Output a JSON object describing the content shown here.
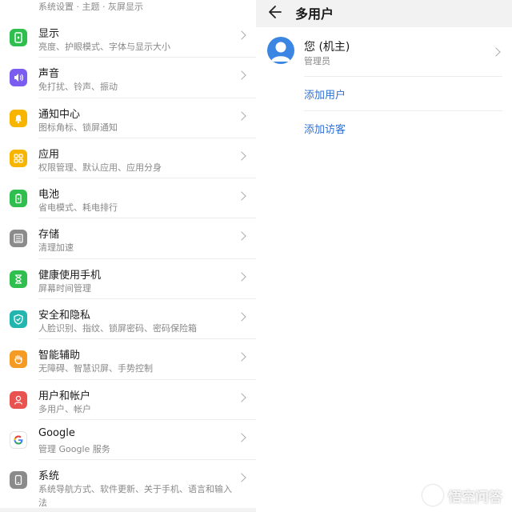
{
  "settings": {
    "partial_top_sub": "系统设置 · 主题 · 灰屏显示",
    "items": [
      {
        "title": "显示",
        "sub": "亮度、护眼模式、字体与显示大小",
        "color": "#2fbf4e",
        "icon": "display-icon"
      },
      {
        "title": "声音",
        "sub": "免打扰、铃声、振动",
        "color": "#7a5cf0",
        "icon": "sound-icon"
      },
      {
        "title": "通知中心",
        "sub": "图标角标、锁屏通知",
        "color": "#f7b500",
        "icon": "bell-icon"
      },
      {
        "title": "应用",
        "sub": "权限管理、默认应用、应用分身",
        "color": "#f7b500",
        "icon": "apps-grid-icon"
      },
      {
        "title": "电池",
        "sub": "省电模式、耗电排行",
        "color": "#2fbf4e",
        "icon": "battery-icon"
      },
      {
        "title": "存储",
        "sub": "清理加速",
        "color": "#8b8b8b",
        "icon": "storage-icon"
      },
      {
        "title": "健康使用手机",
        "sub": "屏幕时间管理",
        "color": "#2fbf4e",
        "icon": "hourglass-icon"
      },
      {
        "title": "安全和隐私",
        "sub": "人脸识别、指纹、锁屏密码、密码保险箱",
        "color": "#23b5b0",
        "icon": "shield-icon"
      },
      {
        "title": "智能辅助",
        "sub": "无障碍、智慧识屏、手势控制",
        "color": "#f59a23",
        "icon": "hand-icon"
      },
      {
        "title": "用户和帐户",
        "sub": "多用户、帐户",
        "color": "#e8524f",
        "icon": "user-icon"
      },
      {
        "title": "Google",
        "sub": "管理 Google 服务",
        "color": "#ffffff",
        "icon": "google-icon"
      },
      {
        "title": "系统",
        "sub": "系统导航方式、软件更新、关于手机、语言和输入法",
        "color": "#8b8b8b",
        "icon": "phone-icon"
      }
    ]
  },
  "multi_user": {
    "title": "多用户",
    "owner_name": "您 (机主)",
    "owner_role": "管理员",
    "add_user": "添加用户",
    "add_guest": "添加访客"
  },
  "watermark": {
    "text": "悟空问答"
  }
}
